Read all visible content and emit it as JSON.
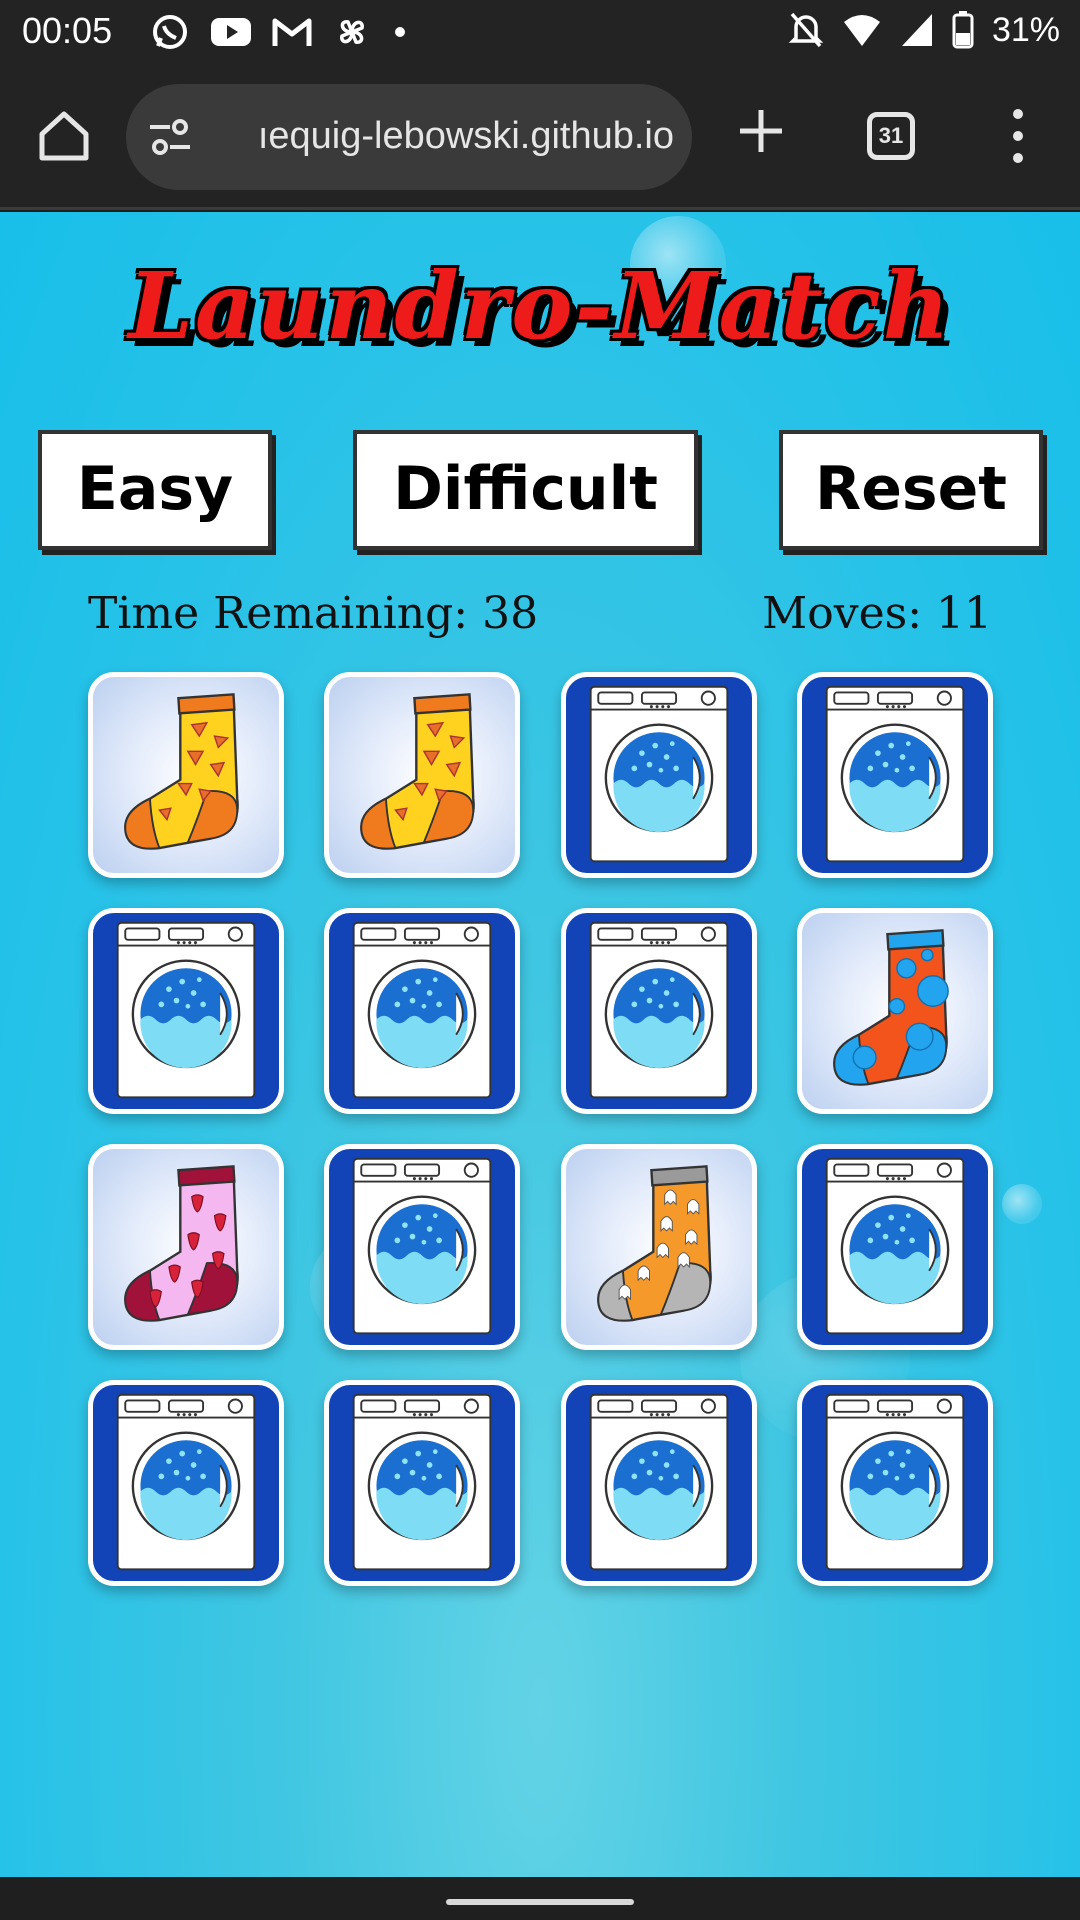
{
  "status_bar": {
    "time": "00:05",
    "battery": "31%",
    "left_icons": [
      "whatsapp-icon",
      "youtube-icon",
      "gmail-icon",
      "pinwheel-icon",
      "dot-icon"
    ],
    "right_icons": [
      "bell-off-icon",
      "wifi-icon",
      "signal-icon",
      "battery-icon"
    ]
  },
  "browser": {
    "url": "lebowski-quig-lebowski.github.io",
    "url_visible": "ıequig-lebowski.github.io",
    "tab_count": "31"
  },
  "game": {
    "title": "Laundro-Match",
    "buttons": {
      "easy": "Easy",
      "difficult": "Difficult",
      "reset": "Reset"
    },
    "time_label": "Time Remaining: 38",
    "moves_label": "Moves: 11",
    "colors": {
      "card_back": "#1244b8",
      "title_red": "#ee1b1b",
      "background": "#27c2e8"
    },
    "cards": [
      {
        "state": "revealed",
        "image": "pizza-sock-icon"
      },
      {
        "state": "revealed",
        "image": "pizza-sock-icon"
      },
      {
        "state": "hidden",
        "image": "washing-machine-icon"
      },
      {
        "state": "hidden",
        "image": "washing-machine-icon"
      },
      {
        "state": "hidden",
        "image": "washing-machine-icon"
      },
      {
        "state": "hidden",
        "image": "washing-machine-icon"
      },
      {
        "state": "hidden",
        "image": "washing-machine-icon"
      },
      {
        "state": "revealed",
        "image": "polka-dot-sock-icon"
      },
      {
        "state": "revealed",
        "image": "strawberry-sock-icon"
      },
      {
        "state": "hidden",
        "image": "washing-machine-icon"
      },
      {
        "state": "revealed",
        "image": "ghost-sock-icon"
      },
      {
        "state": "hidden",
        "image": "washing-machine-icon"
      },
      {
        "state": "hidden",
        "image": "washing-machine-icon"
      },
      {
        "state": "hidden",
        "image": "washing-machine-icon"
      },
      {
        "state": "hidden",
        "image": "washing-machine-icon"
      },
      {
        "state": "hidden",
        "image": "washing-machine-icon"
      }
    ]
  }
}
